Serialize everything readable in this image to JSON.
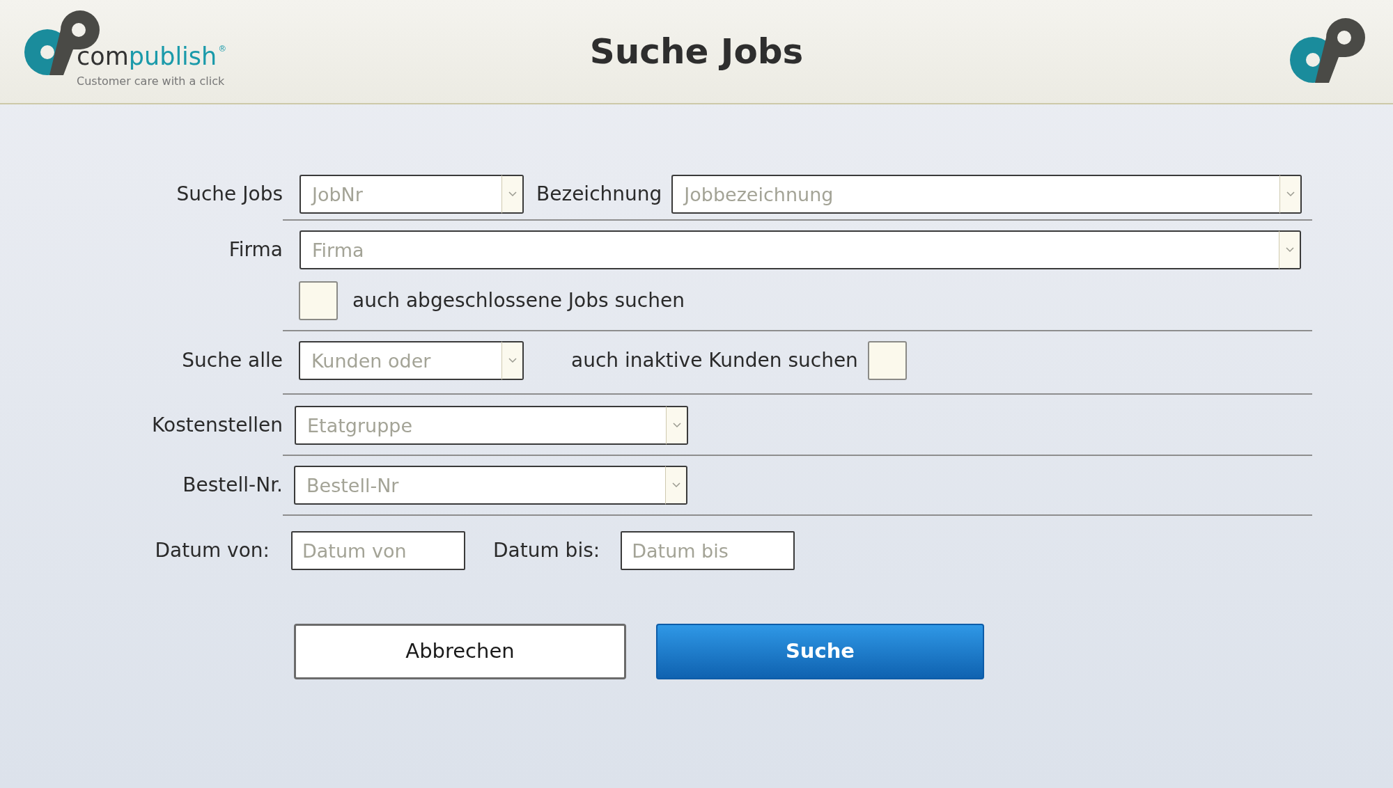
{
  "header": {
    "title": "Suche Jobs",
    "logo": {
      "wordmark_dark": "com",
      "wordmark_light": "publish",
      "registered": "®",
      "tagline": "Customer care with a click"
    }
  },
  "search_jobs": {
    "label": "Suche Jobs",
    "job_number": {
      "placeholder": "JobNr"
    },
    "designation_label": "Bezeichnung",
    "designation": {
      "placeholder": "Jobbezeichnung"
    }
  },
  "company": {
    "label": "Firma",
    "field": {
      "placeholder": "Firma"
    }
  },
  "closed_jobs": {
    "label": "auch abgeschlossene Jobs suchen",
    "checked": false
  },
  "search_all": {
    "label": "Suche alle",
    "field": {
      "placeholder": "Kunden oder"
    },
    "inactive_label": "auch inaktive Kunden suchen",
    "inactive_checked": false
  },
  "cost_centers": {
    "label": "Kostenstellen",
    "field": {
      "placeholder": "Etatgruppe"
    }
  },
  "order_number": {
    "label": "Bestell-Nr.",
    "field": {
      "placeholder": "Bestell-Nr"
    }
  },
  "date": {
    "from_label": "Datum von:",
    "from": {
      "placeholder": "Datum von"
    },
    "to_label": "Datum bis:",
    "to": {
      "placeholder": "Datum bis"
    }
  },
  "buttons": [
    {
      "label": "Abbrechen",
      "kind": "secondary"
    },
    {
      "label": "Suche",
      "kind": "primary"
    }
  ]
}
